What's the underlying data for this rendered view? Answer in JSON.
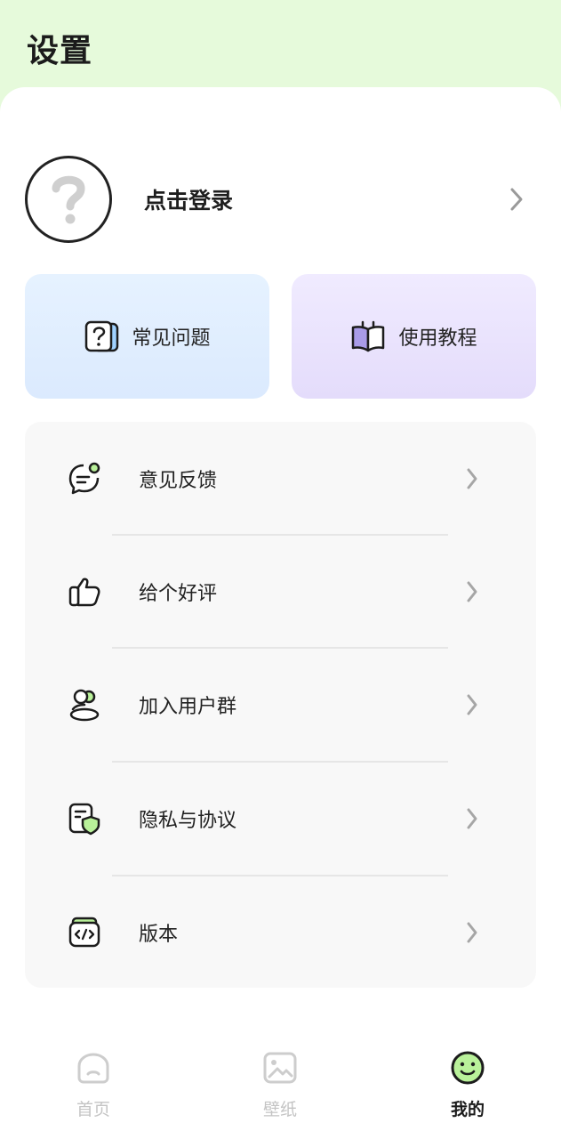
{
  "header": {
    "title": "设置"
  },
  "login": {
    "label": "点击登录",
    "avatar_icon": "question-mark-icon"
  },
  "cards": [
    {
      "label": "常见问题",
      "icon": "faq-icon"
    },
    {
      "label": "使用教程",
      "icon": "book-icon"
    }
  ],
  "menu": [
    {
      "label": "意见反馈",
      "icon": "feedback-icon"
    },
    {
      "label": "给个好评",
      "icon": "thumbs-up-icon"
    },
    {
      "label": "加入用户群",
      "icon": "user-group-icon"
    },
    {
      "label": "隐私与协议",
      "icon": "privacy-shield-icon"
    },
    {
      "label": "版本",
      "icon": "code-version-icon"
    }
  ],
  "nav": [
    {
      "label": "首页",
      "icon": "home-icon",
      "active": false
    },
    {
      "label": "壁纸",
      "icon": "wallpaper-icon",
      "active": false
    },
    {
      "label": "我的",
      "icon": "smiley-icon",
      "active": true
    }
  ],
  "colors": {
    "header_bg": "#e6fadb",
    "accent_green": "#b9f19a",
    "faq_card": "#dbeafe",
    "tutorial_card": "#e4dcfb"
  }
}
